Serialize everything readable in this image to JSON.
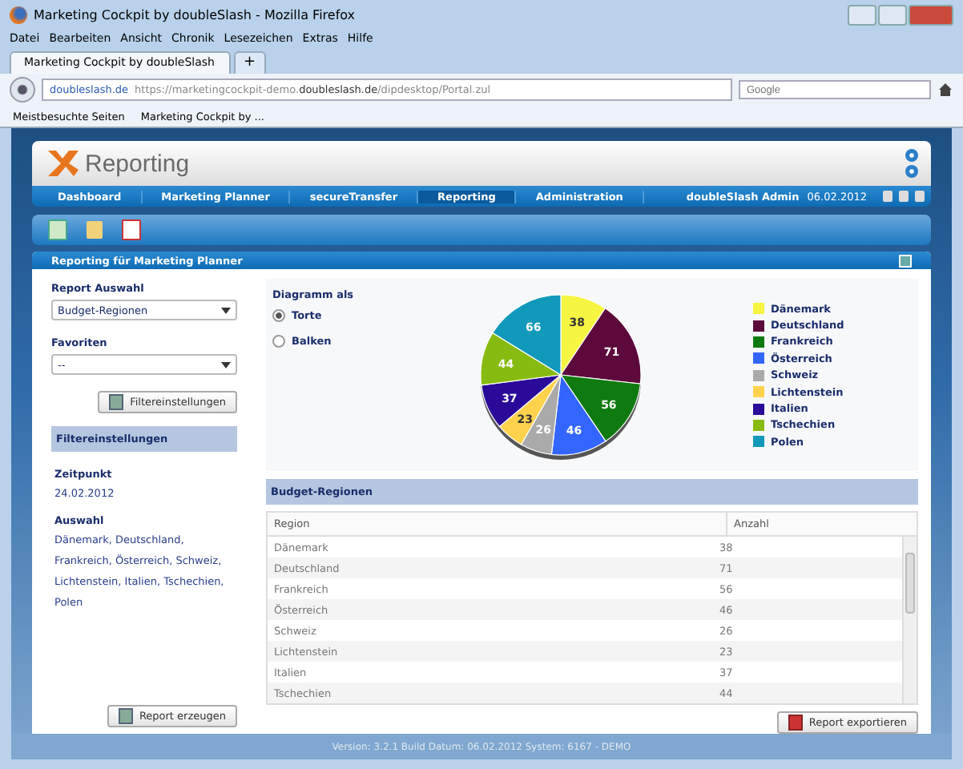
{
  "window": {
    "title": "Marketing Cockpit by doubleSlash - Mozilla Firefox"
  },
  "menu": [
    "Datei",
    "Bearbeiten",
    "Ansicht",
    "Chronik",
    "Lesezeichen",
    "Extras",
    "Hilfe"
  ],
  "browser_tabs": [
    {
      "label": "Marketing Cockpit by doubleSlash",
      "selected": true
    },
    {
      "label": "+",
      "selected": false
    }
  ],
  "address_bar": {
    "site": "doubleslash.de",
    "url_start": "https://marketingcockpit-demo.",
    "url_domain": "doubleslash.de",
    "url_end": "/dipdesktop/Portal.zul"
  },
  "search": {
    "placeholder": "Google"
  },
  "bookmarks": [
    "Meistbesuchte Seiten",
    "Marketing Cockpit by ..."
  ],
  "app": {
    "logo": "Reporting",
    "nav": [
      {
        "label": "Dashboard",
        "selected": false
      },
      {
        "label": "Marketing Planner",
        "selected": false
      },
      {
        "label": "secureTransfer",
        "selected": false
      },
      {
        "label": "Reporting",
        "selected": true
      },
      {
        "label": "Administration",
        "selected": false
      }
    ],
    "user": "doubleSlash Admin",
    "date": "06.02.2012"
  },
  "panel": {
    "title": "Reporting für Marketing Planner",
    "report_label": "Report Auswahl",
    "report_value": "Budget-Regionen",
    "favorites_label": "Favoriten",
    "favorites_value": "--",
    "filter_button": "Filtereinstellungen",
    "filter_header": "Filtereinstellungen",
    "time_label": "Zeitpunkt",
    "time_value": "24.02.2012",
    "selection_label": "Auswahl",
    "selection_value": "Dänemark, Deutschland, Frankreich, Österreich, Schweiz, Lichtenstein, Italien, Tschechien, Polen",
    "generate_button": "Report erzeugen",
    "diagram_label": "Diagramm als",
    "diagram_options": [
      {
        "label": "Torte",
        "selected": true
      },
      {
        "label": "Balken",
        "selected": false
      }
    ],
    "chart_data": {
      "type": "pie",
      "categories": [
        "Dänemark",
        "Deutschland",
        "Frankreich",
        "Österreich",
        "Schweiz",
        "Lichtenstein",
        "Italien",
        "Tschechien",
        "Polen"
      ],
      "values": [
        38,
        71,
        56,
        46,
        26,
        23,
        37,
        44,
        66
      ],
      "data_labels": true
    },
    "legend": [
      {
        "color": "#f5f542"
      },
      {
        "color": "#5c0a3c"
      },
      {
        "color": "#0f7a0f"
      },
      {
        "color": "#3366ff"
      },
      {
        "color": "#aaaaaa"
      },
      {
        "color": "#ffd24d"
      },
      {
        "color": "#2a0a99"
      },
      {
        "color": "#88bb11"
      },
      {
        "color": "#1199bb"
      }
    ],
    "table_title": "Budget-Regionen",
    "table": {
      "columns": [
        "Region",
        "Anzahl"
      ],
      "rows": [
        [
          "Dänemark",
          "38"
        ],
        [
          "Deutschland",
          "71"
        ],
        [
          "Frankreich",
          "56"
        ],
        [
          "Österreich",
          "46"
        ],
        [
          "Schweiz",
          "26"
        ],
        [
          "Lichtenstein",
          "23"
        ],
        [
          "Italien",
          "37"
        ],
        [
          "Tschechien",
          "44"
        ]
      ]
    },
    "export_button": "Report exportieren"
  },
  "status_bar": "Version: 3.2.1 Build Datum: 06.02.2012 System: 6167 - DEMO"
}
